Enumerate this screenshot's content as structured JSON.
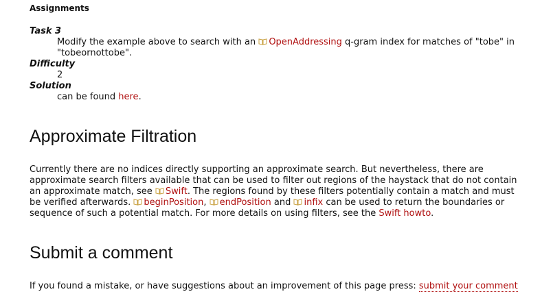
{
  "assignments": {
    "heading": "Assignments"
  },
  "task": {
    "label": "Task 3",
    "text_before": "Modify the example above to search with an ",
    "link": "OpenAddressing",
    "text_middle": " q-gram index for matches of \"tobe\" in",
    "text_line2": "\"tobeornottobe\"."
  },
  "difficulty": {
    "label": "Difficulty",
    "value": "2"
  },
  "solution": {
    "label": "Solution",
    "text_before": "can be found ",
    "link": "here",
    "text_after": "."
  },
  "approx": {
    "heading": "Approximate Filtration",
    "p1": "Currently there are no indices directly supporting an approximate search. But nevertheless, there are",
    "p2": "approximate search filters available that can be used to filter out regions of the haystack that do not contain",
    "p3_before": "an approximate match, see ",
    "p3_link": "Swift",
    "p3_after": ". The regions found by these filters potentially contain a match and must",
    "p4_before": "be verified afterwards. ",
    "p4_link1": "beginPosition",
    "p4_sep1": ", ",
    "p4_link2": "endPosition",
    "p4_sep2": " and ",
    "p4_link3": "infix",
    "p4_after": " can be used to return the boundaries or",
    "p5_before": "sequence of such a potential match. For more details on using filters, see the ",
    "p5_link": "Swift howto",
    "p5_after": "."
  },
  "comment": {
    "heading": "Submit a comment",
    "text": "If you found a mistake, or have suggestions about an improvement of this page press: ",
    "link": "submit your comment"
  },
  "icons": {
    "doc_link": "open-book-icon"
  },
  "colors": {
    "link": "#b01010",
    "icon": "#c8a040"
  }
}
